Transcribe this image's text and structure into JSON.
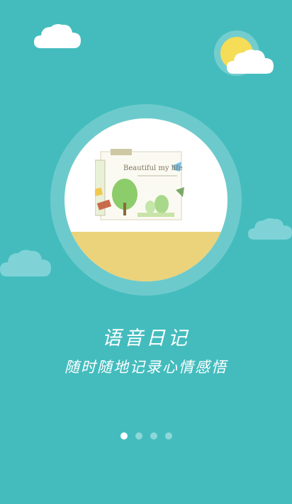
{
  "screen": {
    "title": "语音日记",
    "subtitle": "随时随地记录心情感悟"
  },
  "illustration": {
    "card_heading": "Beautiful my life"
  },
  "pager": {
    "total": 4,
    "active_index": 0
  },
  "colors": {
    "background": "#44bcbe",
    "sun": "#f5dd57",
    "ground": "#ead37b",
    "cloud": "#ffffff",
    "cloud_faded": "#7fd3d7"
  },
  "icons": [
    "cloud-icon",
    "sun-icon"
  ]
}
